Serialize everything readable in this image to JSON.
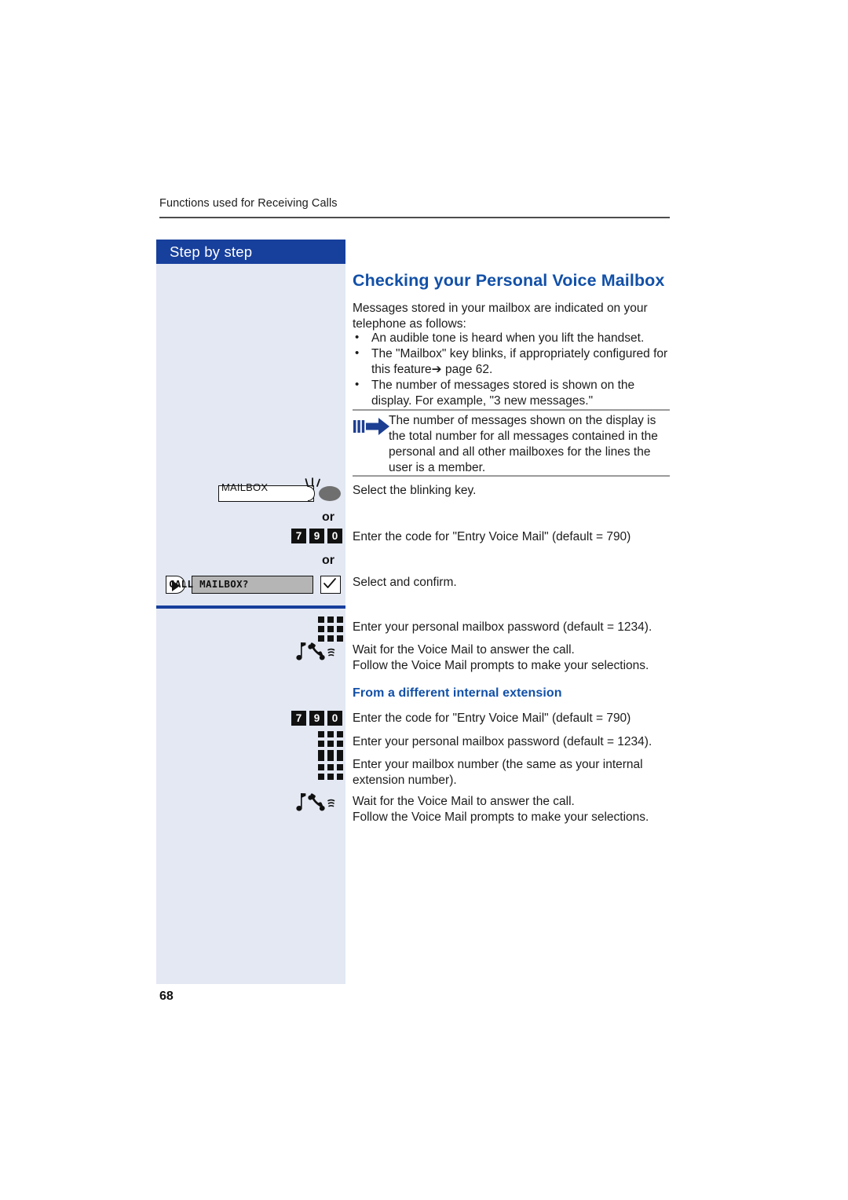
{
  "page": {
    "running_header": "Functions used for Receiving Calls",
    "folio": "68"
  },
  "sidebar": {
    "header_label": "Step by step",
    "mailbox_key": {
      "label": "MAILBOX",
      "icon": "blinking-led-icon"
    },
    "or_1": "or",
    "or_2": "or",
    "digit_keys_1": [
      "7",
      "9",
      "0"
    ],
    "softkey": {
      "display_text": "CALL MAILBOX?",
      "arrow_icon": "play-arrow-icon",
      "confirm_icon": "checkmark-icon"
    }
  },
  "main": {
    "title": "Checking your Personal Voice Mailbox",
    "intro": "Messages stored in your mailbox are indicated on your telephone as follows:",
    "bullets": [
      "An audible tone is heard when you lift the handset.",
      "The \"Mailbox\" key blinks, if appropriately configured for this feature➔ page 62.",
      "The number of messages stored is shown on the display. For example, \"3 new messages.\""
    ],
    "note": {
      "icon": "blue-arrow-note-icon",
      "text": "The number of messages shown on the display is the total number for all messages contained in the personal and all other mailboxes for the lines the user is a member."
    },
    "steps": {
      "select_blinking_key": "Select the blinking key.",
      "enter_code_1": "Enter the code for \"Entry Voice Mail\" (default = 790)",
      "select_and_confirm": "Select and confirm.",
      "password_1": "Enter your personal mailbox password (default = 1234).",
      "wait_1": "Wait for the Voice Mail to answer the call.",
      "follow_1": "Follow the Voice Mail prompts to make your selections."
    },
    "subheading": "From a different internal extension",
    "steps2": {
      "digit_keys": [
        "7",
        "9",
        "0"
      ],
      "enter_code_2": "Enter the code for \"Entry Voice Mail\" (default = 790)",
      "password_2": "Enter your personal mailbox password (default = 1234).",
      "mailbox_number": "Enter your mailbox number (the same as your internal extension number).",
      "wait_2": "Wait for the Voice Mail to answer the call.",
      "follow_2": "Follow the Voice Mail prompts to make your selections."
    }
  },
  "colors": {
    "brand_blue": "#173f9c",
    "heading_blue": "#1250a8",
    "sidebar_bg": "#e3e8f2",
    "rule_gray": "#9a9a9a"
  }
}
